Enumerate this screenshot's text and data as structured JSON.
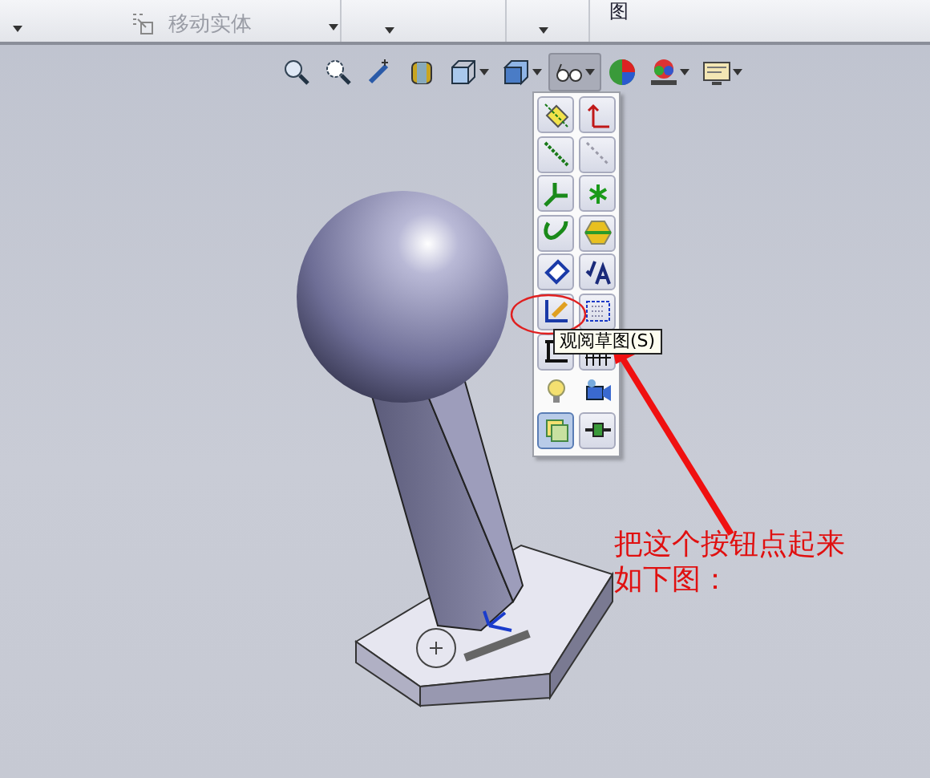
{
  "ribbon": {
    "items": [
      {
        "kind": "command",
        "text": "移动实体"
      },
      {
        "kind": "label_dark",
        "text": "图"
      }
    ]
  },
  "view_toolbar": [
    {
      "dropdown": false,
      "selected": false
    },
    {
      "dropdown": false,
      "selected": false
    },
    {
      "dropdown": false,
      "selected": false
    },
    {
      "dropdown": false,
      "selected": false
    },
    {
      "dropdown": true,
      "selected": false
    },
    {
      "dropdown": true,
      "selected": false
    },
    {
      "dropdown": true,
      "selected": true
    },
    {
      "dropdown": false,
      "selected": false
    },
    {
      "dropdown": true,
      "selected": false
    },
    {
      "dropdown": true,
      "selected": false
    }
  ],
  "popup_buttons": [
    {
      "selected": false
    },
    {
      "selected": false
    },
    {
      "selected": false
    },
    {
      "selected": false
    },
    {
      "selected": false
    },
    {
      "selected": false
    },
    {
      "selected": false
    },
    {
      "selected": false
    },
    {
      "selected": false
    },
    {
      "selected": false
    },
    {
      "selected": false
    },
    {
      "selected": false
    },
    {
      "selected": false
    },
    {
      "selected": false
    },
    {
      "selected": false
    },
    {
      "selected": false
    },
    {
      "selected": true
    },
    {
      "selected": false
    }
  ],
  "tooltip": "观阅草图(S)",
  "annotation": [
    "把这个按钮点起来",
    "如下图："
  ]
}
